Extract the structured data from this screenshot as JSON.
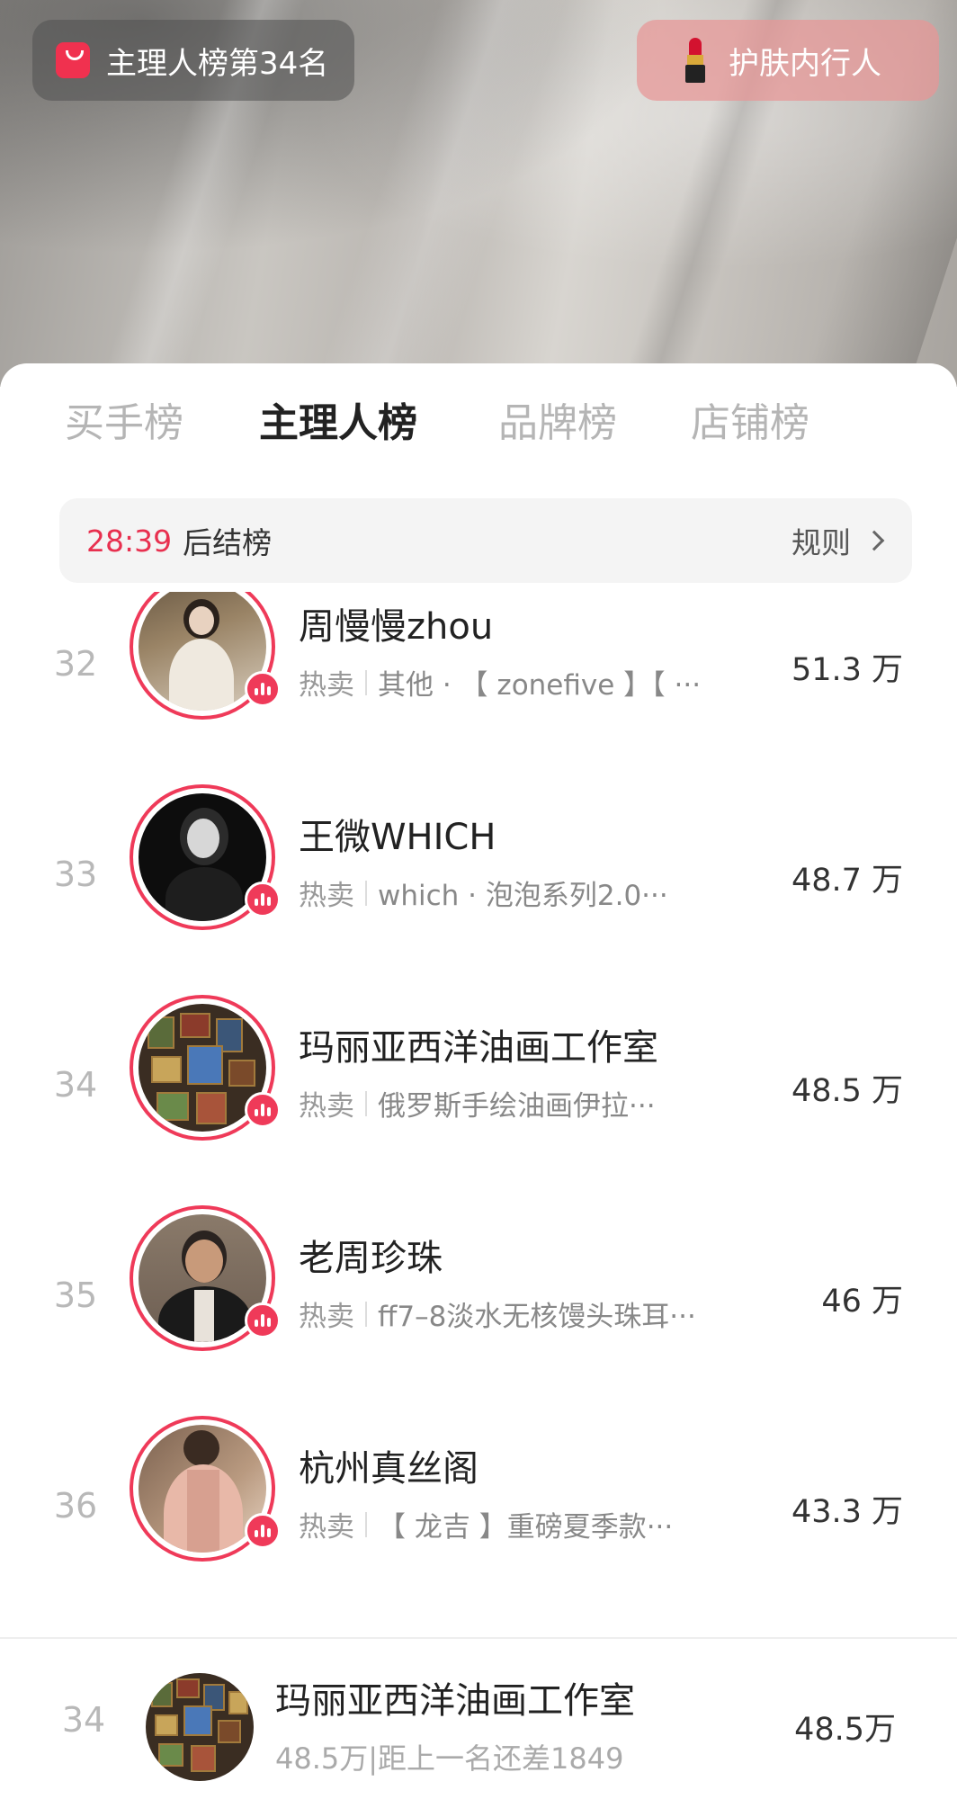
{
  "live": {
    "rank_badge": "主理人榜第34名",
    "tag_label": "护肤内行人"
  },
  "tabs": [
    {
      "label": "买手榜",
      "active": false
    },
    {
      "label": "主理人榜",
      "active": true
    },
    {
      "label": "品牌榜",
      "active": false
    },
    {
      "label": "店铺榜",
      "active": false
    }
  ],
  "countdown": {
    "time": "28:39",
    "suffix": "后结榜",
    "rules_label": "规则"
  },
  "rows": [
    {
      "rank": "32",
      "name": "周慢慢zhou",
      "hot_label": "热卖",
      "product": "其他 · 【 zonefive 】【 ···",
      "score": "51.3 万",
      "avatar": "woman-white-dress"
    },
    {
      "rank": "33",
      "name": "王微WHICH",
      "hot_label": "热卖",
      "product": "which · 泡泡系列2.0···",
      "score": "48.7 万",
      "avatar": "woman-black-white"
    },
    {
      "rank": "34",
      "name": "玛丽亚西洋油画工作室",
      "hot_label": "热卖",
      "product": "俄罗斯手绘油画伊拉···",
      "score": "48.5 万",
      "avatar": "painting-wall"
    },
    {
      "rank": "35",
      "name": "老周珍珠",
      "hot_label": "热卖",
      "product": "ff7–8淡水无核馒头珠耳···",
      "score": "46 万",
      "avatar": "man-black-jacket"
    },
    {
      "rank": "36",
      "name": "杭州真丝阁",
      "hot_label": "热卖",
      "product": "【 龙吉 】重磅夏季款···",
      "score": "43.3 万",
      "avatar": "woman-silk-jacket"
    }
  ],
  "my_rank": {
    "rank": "34",
    "name": "玛丽亚西洋油画工作室",
    "gap_text": "48.5万|距上一名还差1849",
    "score": "48.5万"
  },
  "colors": {
    "accent": "#ef3a59",
    "countdown": "#e8304f"
  }
}
